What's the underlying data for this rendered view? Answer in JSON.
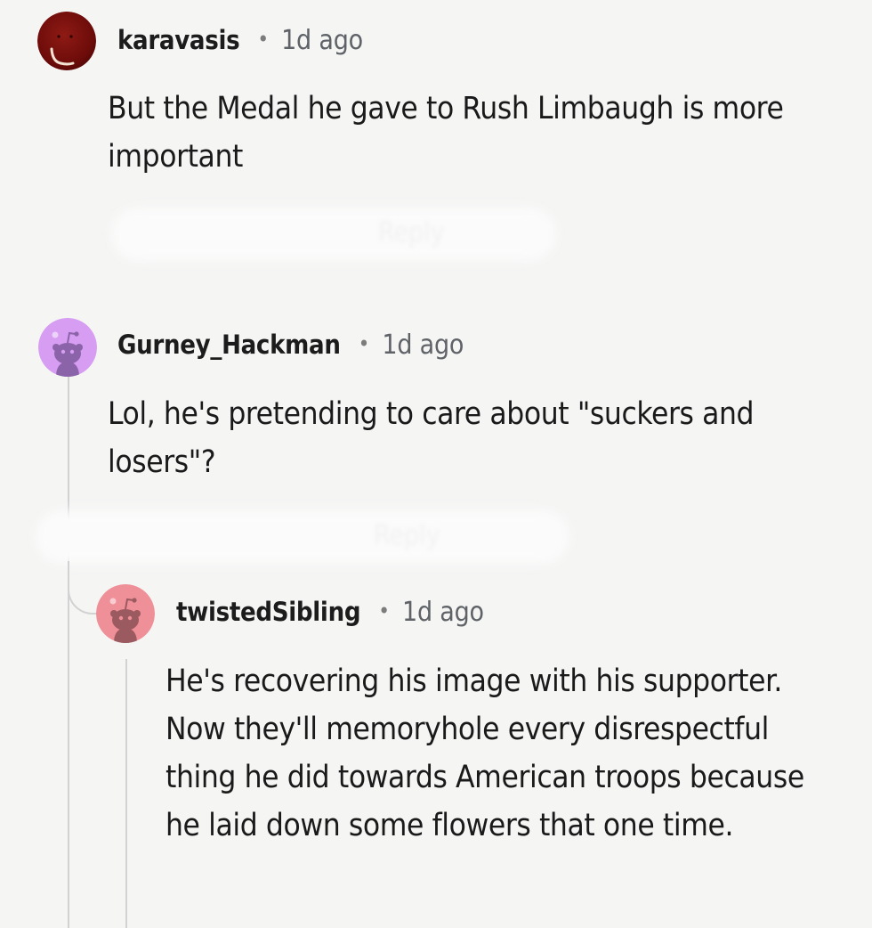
{
  "comments": [
    {
      "username": "karavasis",
      "separator": "•",
      "timestamp": "1d ago",
      "body": "But the Medal he gave to Rush Limbaugh is more important",
      "avatar_color": "#7a0e0e",
      "avatar_icon": "custom-avatar-icon"
    },
    {
      "username": "Gurney_Hackman",
      "separator": "•",
      "timestamp": "1d ago",
      "body": "Lol, he's pretending to care about \"suckers and losers\"?",
      "avatar_color": "#d69df2",
      "avatar_icon": "snoo-avatar-icon"
    },
    {
      "username": "twistedSibling",
      "separator": "•",
      "timestamp": "1d ago",
      "body": "He's recovering his image with his supporter. Now they'll memoryhole every disrespectful thing he did towards American troops because he laid down some flowers that one time.",
      "avatar_color": "#ef8f98",
      "avatar_icon": "snoo-avatar-icon"
    }
  ],
  "actions": {
    "reply_label": "Reply"
  },
  "colors": {
    "background": "#f5f5f4",
    "thread_line": "#d2d2d2",
    "timestamp": "#5f6368"
  }
}
